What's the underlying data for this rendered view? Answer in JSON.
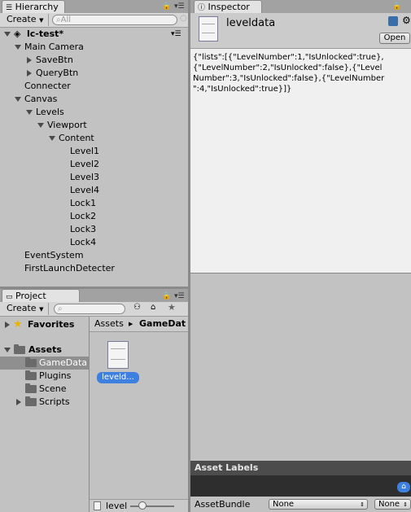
{
  "hierarchy": {
    "tab_label": "Hierarchy",
    "create_label": "Create",
    "search_placeholder": "All",
    "scene_name": "lc-test*",
    "items": [
      {
        "label": "Main Camera",
        "depth": 1,
        "arrow": "down"
      },
      {
        "label": "SaveBtn",
        "depth": 2,
        "arrow": "right"
      },
      {
        "label": "QueryBtn",
        "depth": 2,
        "arrow": "right"
      },
      {
        "label": "Connecter",
        "depth": 1,
        "arrow": ""
      },
      {
        "label": "Canvas",
        "depth": 1,
        "arrow": "down"
      },
      {
        "label": "Levels",
        "depth": 2,
        "arrow": "down"
      },
      {
        "label": "Viewport",
        "depth": 3,
        "arrow": "down"
      },
      {
        "label": "Content",
        "depth": 4,
        "arrow": "down"
      },
      {
        "label": "Level1",
        "depth": 5,
        "arrow": ""
      },
      {
        "label": "Level2",
        "depth": 5,
        "arrow": ""
      },
      {
        "label": "Level3",
        "depth": 5,
        "arrow": ""
      },
      {
        "label": "Level4",
        "depth": 5,
        "arrow": ""
      },
      {
        "label": "Lock1",
        "depth": 5,
        "arrow": ""
      },
      {
        "label": "Lock2",
        "depth": 5,
        "arrow": ""
      },
      {
        "label": "Lock3",
        "depth": 5,
        "arrow": ""
      },
      {
        "label": "Lock4",
        "depth": 5,
        "arrow": ""
      },
      {
        "label": "EventSystem",
        "depth": 1,
        "arrow": ""
      },
      {
        "label": "FirstLaunchDetecter",
        "depth": 1,
        "arrow": ""
      }
    ]
  },
  "inspector": {
    "tab_label": "Inspector",
    "asset_name": "leveldata",
    "open_label": "Open",
    "content_lines": [
      "{\"lists\":[{\"LevelNumber\":1,\"IsUnlocked\":true},",
      "{\"LevelNumber\":2,\"IsUnlocked\":false},{\"Level",
      "Number\":3,\"IsUnlocked\":false},{\"LevelNumber",
      "\":4,\"IsUnlocked\":true}]}"
    ],
    "asset_labels_title": "Asset Labels",
    "assetbundle_label": "AssetBundle",
    "assetbundle_value": "None",
    "assetbundle_variant": "None"
  },
  "project": {
    "tab_label": "Project",
    "create_label": "Create",
    "favorites_label": "Favorites",
    "assets_label": "Assets",
    "folders": [
      {
        "label": "GameData",
        "selected": true,
        "arrow": false
      },
      {
        "label": "Plugins",
        "selected": false,
        "arrow": false
      },
      {
        "label": "Scene",
        "selected": false,
        "arrow": false
      },
      {
        "label": "Scripts",
        "selected": false,
        "arrow": true
      }
    ],
    "breadcrumb_root": "Assets",
    "breadcrumb_current": "GameDat",
    "file_label": "leveld...",
    "footer_file": "level"
  },
  "colors": {
    "selection": "#3d80df",
    "panel": "#c2c2c2",
    "dark_header": "#4c4c4c"
  }
}
